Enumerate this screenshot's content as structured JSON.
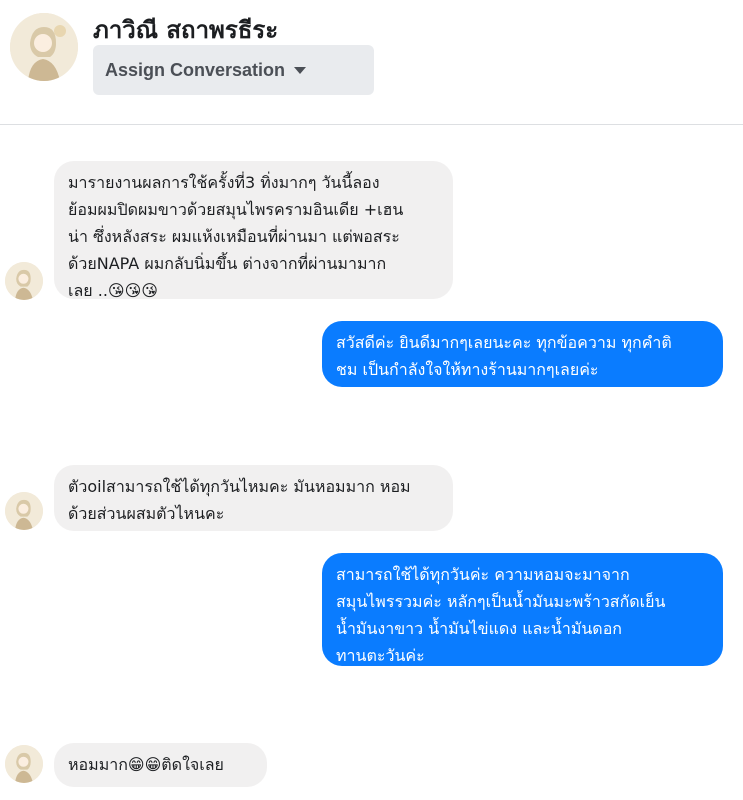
{
  "header": {
    "contact_name": "ภาวิณี สถาพรธีระ",
    "assign_label": "Assign Conversation"
  },
  "messages": [
    {
      "direction": "in",
      "text": "มารายงานผลการใช้ครั้งที่3 ทิ่งมากๆ วันนี้ลอง\nย้อมผมปิดผมขาวด้วยสมุนไพรครามอินเดีย +เฮน\nน่า ซึ่งหลังสระ ผมแห้งเหมือนที่ผ่านมา แต่พอสระ\nด้วยNAPA  ผมกลับนิ่มขึ้น ต่างจากที่ผ่านมามาก\nเลย ..😘😘😘"
    },
    {
      "direction": "out",
      "text": "สวัสดีค่ะ ยินดีมากๆเลยนะคะ ทุกข้อความ ทุกคำติ\nชม เป็นกำลังใจให้ทางร้านมากๆเลยค่ะ"
    },
    {
      "direction": "in",
      "text": "ตัวoilสามารถใช้ได้ทุกวันไหมคะ มันหอมมาก หอม\nด้วยส่วนผสมตัวไหนคะ"
    },
    {
      "direction": "out",
      "text": "สามารถใช้ได้ทุกวันค่ะ ความหอมจะมาจาก\nสมุนไพรรวมค่ะ หลักๆเป็นน้ำมันมะพร้าวสกัดเย็น\nน้ำมันงาขาว น้ำมันไข่แดง และน้ำมันดอก\nทานตะวันค่ะ"
    },
    {
      "direction": "in",
      "text": "หอมมาก😁😁ติดใจเลย"
    }
  ]
}
